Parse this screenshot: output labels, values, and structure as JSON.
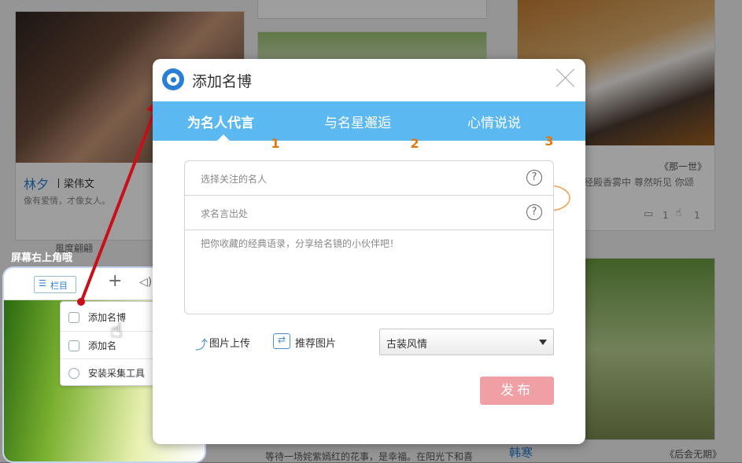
{
  "background": {
    "card1": {
      "name": "林夕",
      "sep": "丨梁伟文",
      "desc": "像有爱情，才像女人。"
    },
    "card1_footer": "風度翩翩",
    "card3": {
      "text": "经殿香雾中 尊然听见 你颂",
      "quote_title": "《那一世》",
      "comments": "1",
      "likes": "1"
    },
    "bottom_card": {
      "text": "等待一场姹紫嫣红的花事，是幸福。在阳光下和喜"
    },
    "bottom_right": {
      "name": "韩寒",
      "quote_title": "《后会无期》"
    }
  },
  "dialog": {
    "title": "添加名博",
    "tabs": [
      {
        "label": "为名人代言",
        "badge": "1"
      },
      {
        "label": "与名星邂逅",
        "badge": "2"
      },
      {
        "label": "心情说说",
        "badge": "3"
      }
    ],
    "celebrity_placeholder": "选择关注的名人",
    "source_placeholder": "求名言出处",
    "help_glyph": "?",
    "quote_placeholder": "把你收藏的经典语录，分享给名镜的小伙伴吧！",
    "upload_label": "图片上传",
    "recommend_label": "推荐图片",
    "style_select": "古装风情",
    "publish_label": "发布"
  },
  "inset": {
    "caption": "屏幕右上角哦",
    "toolbar_column_label": "栏目",
    "plus": "+",
    "menu": [
      "添加名博",
      "添加名",
      "安装采集工具"
    ]
  },
  "colors": {
    "tab_bg": "#5cb8f0",
    "badge": "#e07a10",
    "publish": "#f0a0a4",
    "arrow": "#c8101a"
  }
}
